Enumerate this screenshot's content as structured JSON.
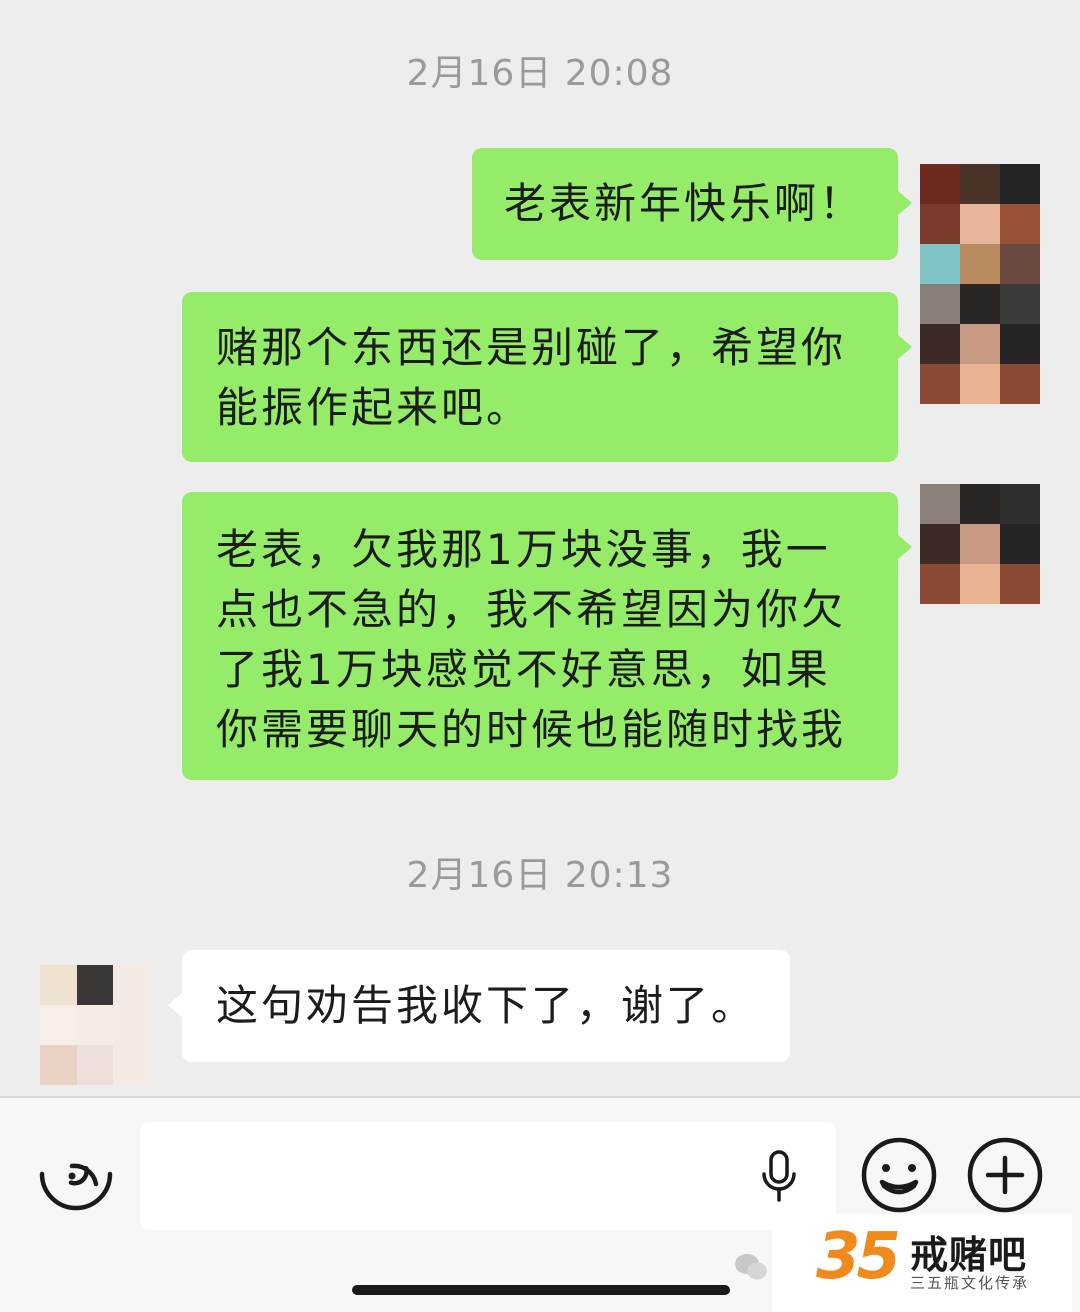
{
  "messages": [
    {
      "timestamp": "2月16日 20:08"
    },
    {
      "direction": "outgoing",
      "text": "老表新年快乐啊！"
    },
    {
      "direction": "outgoing",
      "text": "赌那个东西还是别碰了，希望你能振作起来吧。"
    },
    {
      "direction": "outgoing",
      "text": "老表，欠我那1万块没事，我一点也不急的，我不希望因为你欠了我1万块感觉不好意思，如果你需要聊天的时候也能随时找我"
    },
    {
      "timestamp": "2月16日 20:13"
    },
    {
      "direction": "incoming",
      "text": "这句劝告我收下了，谢了。"
    }
  ],
  "avatars": {
    "self_a": [
      "#6e2a1f",
      "#4a3329",
      "#232323",
      "#7a3b2c",
      "#e8b59a",
      "#9a5237",
      "#7fc3c4",
      "#b88a60",
      "#6a4a40",
      "#888078",
      "#2a2624",
      "#3a3a3a",
      "#3c2a24",
      "#c89a84",
      "#262424",
      "#8a4a34",
      "#e9b394",
      "#8a4a34"
    ],
    "self_b": [
      "#8a8078",
      "#2a2624",
      "#2e2e2e",
      "#3c2a24",
      "#c89a84",
      "#262424",
      "#8a4a34",
      "#e9b394",
      "#8a4a34"
    ],
    "friend": [
      "#efe1cf",
      "#3a3636",
      "#f3ebe3",
      "#f7efe7",
      "#f6ece4",
      "#f3ebe3",
      "#e9d2c4",
      "#efdfdb",
      "#f3ebe3"
    ]
  },
  "input_bar": {
    "voice_toggle_icon": "voice-wave-icon",
    "mic_icon": "microphone-icon",
    "emoji_icon": "smiley-face-icon",
    "more_icon": "plus-circle-icon",
    "value": ""
  },
  "watermark": {
    "number": "35",
    "title": "戒赌吧",
    "subtitle": "三五瓶文化传承"
  },
  "colors": {
    "background": "#ededed",
    "outgoing_bubble": "#95ec69",
    "incoming_bubble": "#ffffff",
    "timestamp": "#9a9a9a"
  }
}
